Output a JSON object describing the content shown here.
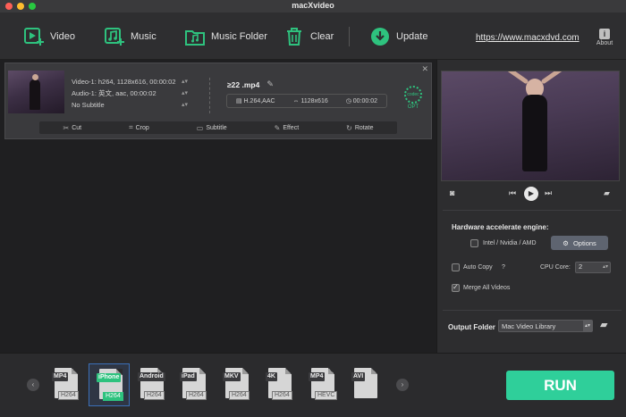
{
  "window": {
    "title": "macXvideo"
  },
  "toolbar": {
    "video_label": "Video",
    "music_label": "Music",
    "music_folder_label": "Music Folder",
    "clear_label": "Clear",
    "update_label": "Update",
    "website": "https://www.macxdvd.com",
    "about_label": "About"
  },
  "task": {
    "video_track": "Video-1: h264, 1128x616, 00:00:02",
    "audio_track": "Audio-1: 英文, aac, 00:00:02",
    "subtitle": "No Subtitle",
    "output_name": "≥22 .mp4",
    "codec_spec": "H.264,AAC",
    "resolution": "1128x616",
    "duration": "00:00:02",
    "codec_icon_text": "codec",
    "opt_label": "OPT",
    "close_glyph": "✕",
    "edit_tools": [
      {
        "label": "Cut",
        "icon": "✂"
      },
      {
        "label": "Crop",
        "icon": "⌗"
      },
      {
        "label": "Subtitle",
        "icon": "▭"
      },
      {
        "label": "Effect",
        "icon": "✎"
      },
      {
        "label": "Rotate",
        "icon": "↻"
      }
    ]
  },
  "player": {
    "snapshot_icon": "camera-icon",
    "prev_icon": "skip-back-icon",
    "play_icon": "play-icon",
    "next_icon": "skip-forward-icon",
    "folder_icon": "folder-open-icon"
  },
  "settings": {
    "hw_title": "Hardware accelerate engine:",
    "intel_label": "Intel / Nvidia / AMD",
    "intel_checked": false,
    "options_label": "Options",
    "auto_copy_label": "Auto Copy",
    "auto_copy_help": "?",
    "auto_copy_checked": false,
    "cpu_core_label": "CPU Core:",
    "cpu_core_value": "2",
    "merge_label": "Merge All Videos",
    "merge_checked": true,
    "output_folder_label": "Output Folder",
    "output_folder_value": "Mac Video Library"
  },
  "formats": [
    {
      "top": "MP4",
      "bottom": "H264",
      "selected": false
    },
    {
      "top": "iPhone",
      "bottom": "H264",
      "selected": true
    },
    {
      "top": "Android",
      "bottom": "H264",
      "selected": false
    },
    {
      "top": "iPad",
      "bottom": "H264",
      "selected": false
    },
    {
      "top": "MKV",
      "bottom": "H264",
      "selected": false
    },
    {
      "top": "4K",
      "bottom": "H264",
      "selected": false
    },
    {
      "top": "MP4",
      "bottom": "HEVC",
      "selected": false
    },
    {
      "top": "AVI",
      "bottom": "",
      "selected": false
    }
  ],
  "run_label": "RUN",
  "colors": {
    "accent": "#2fcf9a",
    "selection": "#3b6fb8",
    "codec_green": "#2ec27e"
  }
}
